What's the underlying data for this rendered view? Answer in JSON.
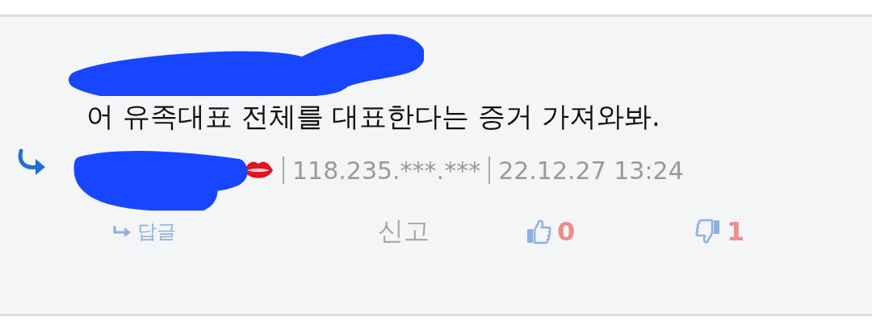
{
  "comment": {
    "text": "어 유족대표 전체를 대표한다는 증거 가져와봐.",
    "is_reply": true,
    "ip": "118.235.***.***",
    "date": "22.12.27 13:24"
  },
  "actions": {
    "reply": "답글",
    "report": "신고",
    "likes": "0",
    "dislikes": "1"
  }
}
